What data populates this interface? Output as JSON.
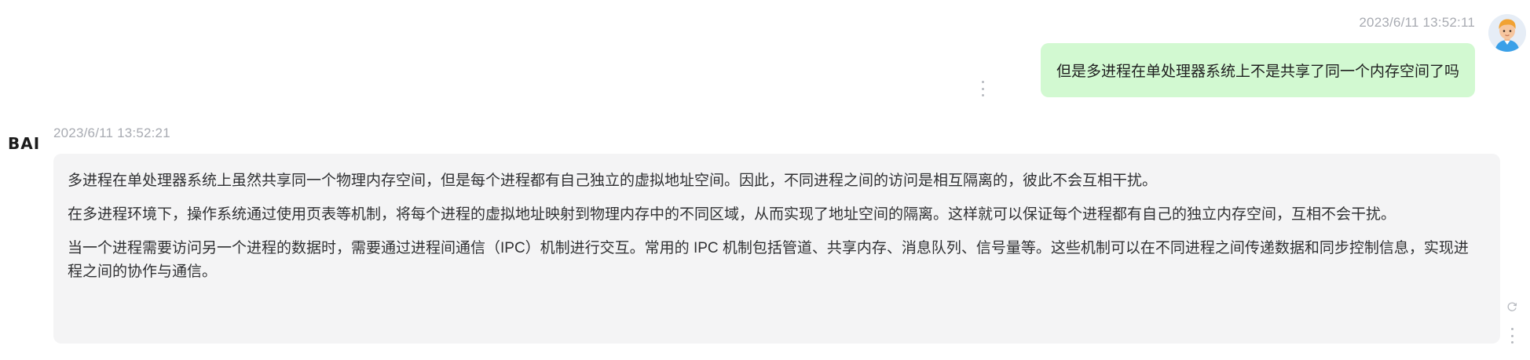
{
  "user_message": {
    "timestamp": "2023/6/11 13:52:11",
    "text": "但是多进程在单处理器系统上不是共享了同一个内存空间了吗",
    "avatar_icon": "user-avatar-icon",
    "bubble_color": "#d2f9d1"
  },
  "assistant_message": {
    "logo": "BAI",
    "timestamp": "2023/6/11 13:52:21",
    "bubble_color": "#f4f4f5",
    "paragraphs": [
      "多进程在单处理器系统上虽然共享同一个物理内存空间，但是每个进程都有自己独立的虚拟地址空间。因此，不同进程之间的访问是相互隔离的，彼此不会互相干扰。",
      "在多进程环境下，操作系统通过使用页表等机制，将每个进程的虚拟地址映射到物理内存中的不同区域，从而实现了地址空间的隔离。这样就可以保证每个进程都有自己的独立内存空间，互相不会干扰。",
      "当一个进程需要访问另一个进程的数据时，需要通过进程间通信（IPC）机制进行交互。常用的 IPC 机制包括管道、共享内存、消息队列、信号量等。这些机制可以在不同进程之间传递数据和同步控制信息，实现进程之间的协作与通信。"
    ]
  }
}
